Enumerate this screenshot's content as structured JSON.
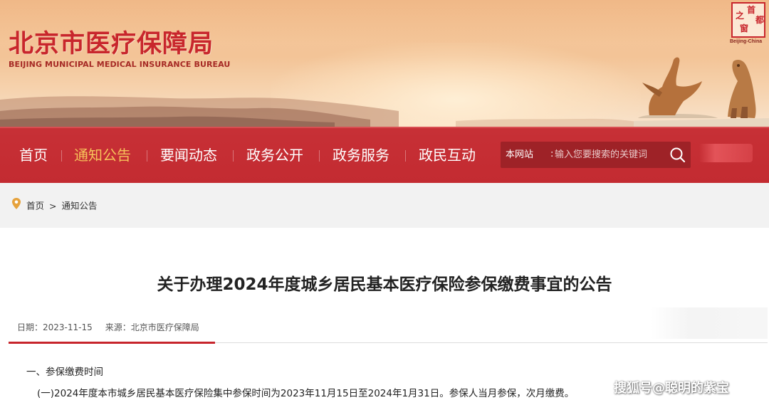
{
  "header": {
    "site_name_cn": "北京市医疗保障局",
    "site_name_en": "BEIJING MUNICIPAL MEDICAL INSURANCE BUREAU",
    "seal": {
      "chars": [
        "首",
        "都",
        "之",
        "窗"
      ],
      "caption": "Beijing-China"
    }
  },
  "nav": {
    "items": [
      {
        "label": "首页",
        "active": false
      },
      {
        "label": "通知公告",
        "active": true
      },
      {
        "label": "要闻动态",
        "active": false
      },
      {
        "label": "政务公开",
        "active": false
      },
      {
        "label": "政务服务",
        "active": false
      },
      {
        "label": "政民互动",
        "active": false
      }
    ],
    "active_color": "#f7c25a",
    "bar_color": "#c52d33"
  },
  "search": {
    "scope_label": "本网站",
    "colon": ":",
    "placeholder": "输入您要搜索的关键词",
    "button_icon": "search-icon"
  },
  "breadcrumb": {
    "icon": "location-pin-icon",
    "home": "首页",
    "separator": ">",
    "current": "通知公告"
  },
  "article": {
    "title": "关于办理2024年度城乡居民基本医疗保险参保缴费事宜的公告",
    "date_label": "日期：2023-11-15",
    "source_label": "来源：北京市医疗保障局",
    "section_1_heading": "一、参保缴费时间",
    "section_1_para_1": "(一)2024年度本市城乡居民基本医疗保险集中参保时间为2023年11月15日至2024年1月31日。参保人当月参保，次月缴费。",
    "accent_color": "#c7252c"
  },
  "watermark": "搜狐号@聪明的紫宝"
}
